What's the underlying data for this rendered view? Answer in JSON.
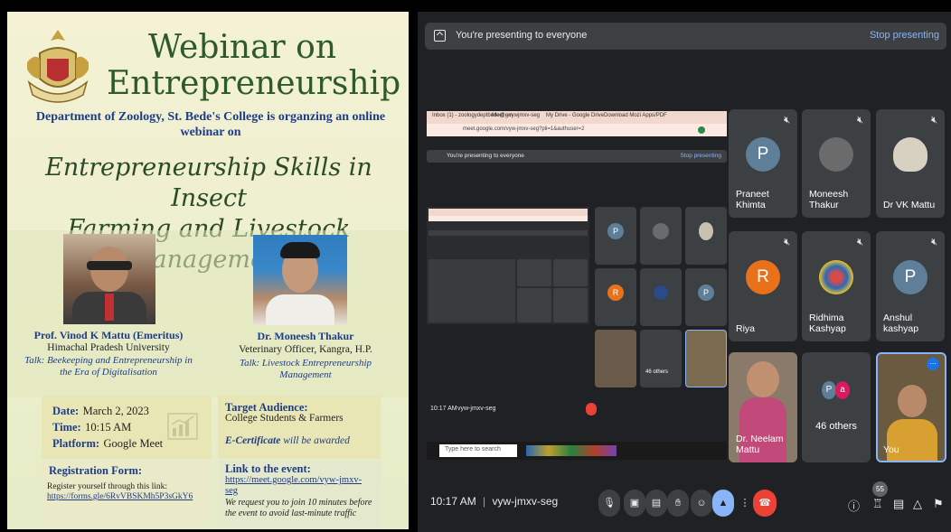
{
  "poster": {
    "title_line1": "Webinar on",
    "title_line2": "Entrepreneurship",
    "dept_line1": "Department of Zoology, St. Bede's College is organzing an online",
    "dept_line2": "webinar on",
    "topic_line1": "Entrepreneurship Skills in Insect",
    "topic_line2": "Farming and Livestock Management",
    "speaker1": {
      "name": "Prof. Vinod K Mattu (Emeritus)",
      "affiliation": "Himachal Pradesh University",
      "talk_line1": "Talk: Beekeeping and Entrepreneurship in",
      "talk_line2": "the Era of Digitalisation"
    },
    "speaker2": {
      "name": "Dr. Moneesh Thakur",
      "affiliation": "Veterinary Officer, Kangra, H.P.",
      "talk_line1": "Talk: Livestock Entrepreneurship",
      "talk_line2": "Management"
    },
    "date_label": "Date:",
    "date_value": "March 2, 2023",
    "time_label": "Time:",
    "time_value": "10:15 AM",
    "platform_label": "Platform:",
    "platform_value": "Google Meet",
    "audience_label": "Target Audience:",
    "audience_value": "College Students & Farmers",
    "certificate_label": "E-Certificate",
    "certificate_value": "will be awarded",
    "registration_label": "Registration Form:",
    "registration_text": "Register yourself through this link:",
    "registration_link": "https://forms.gle/6RvVBSKMh5P3sGkY6",
    "event_label": "Link to the event:",
    "event_link_line1": "https://meet.google.com/vyw-jmxv-",
    "event_link_line2": "seg",
    "event_note_line1": "We request you to join 10 minutes before",
    "event_note_line2": "the event to avoid last-minute traffic"
  },
  "meet": {
    "banner_text": "You're presenting to everyone",
    "stop_label": "Stop presenting",
    "participants": [
      {
        "name": "Praneet Khimta",
        "initial": "P",
        "color": "#5f7f99"
      },
      {
        "name": "Moneesh Thakur",
        "initial": "",
        "color": "#6b6b6b"
      },
      {
        "name": "Dr VK Mattu",
        "initial": "",
        "color": "#8a8a8a"
      },
      {
        "name": "Riya",
        "initial": "R",
        "color": "#e8711a"
      },
      {
        "name": "Ridhima Kashyap",
        "initial": "",
        "color": "#3c4043"
      },
      {
        "name": "Anshul kashyap",
        "initial": "P",
        "color": "#5f7f99"
      },
      {
        "name": "Dr. Neelam Mattu",
        "initial": "",
        "color": "#9a6a6a"
      },
      {
        "name": "46 others",
        "initial": "",
        "color": "#3c4043"
      },
      {
        "name": "You",
        "initial": "",
        "color": "#7a6a50"
      }
    ],
    "others_initials": [
      "P",
      "a"
    ],
    "time": "10:17 AM",
    "divider": "|",
    "meeting_code": "vyw-jmxv-seg",
    "participant_count": "55"
  },
  "shared_screen": {
    "tab1": "Inbox (1) - zoologydeptbede@gm",
    "tab2": "Meet - vywjmxv-seg",
    "tab3": "My Drive - Google Drive",
    "tab4": "Download Mozi Apps/PDF",
    "url": "meet.google.com/vyw-jmxv-seg?pli=1&authuser=2",
    "banner_text": "You're presenting to everyone",
    "stop_label": "Stop presenting",
    "time": "10:17 AM",
    "meeting_code": "vyw-jmxv-seg",
    "search_placeholder": "Type here to search",
    "others": "46 others"
  }
}
